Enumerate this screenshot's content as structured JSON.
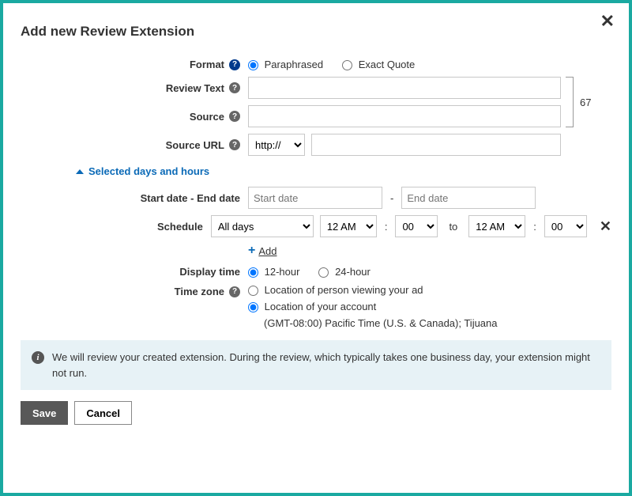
{
  "title": "Add new Review Extension",
  "labels": {
    "format": "Format",
    "review_text": "Review Text",
    "source": "Source",
    "source_url": "Source URL",
    "start_end": "Start date - End date",
    "schedule": "Schedule",
    "display_time": "Display time",
    "time_zone": "Time zone"
  },
  "format": {
    "paraphrased": "Paraphrased",
    "exact_quote": "Exact Quote"
  },
  "counter": "67",
  "source_url": {
    "protocol": "http://"
  },
  "section_toggle": "Selected days and hours",
  "date": {
    "start_ph": "Start date",
    "end_ph": "End date"
  },
  "schedule": {
    "days": "All days",
    "hour1": "12 AM",
    "min1": "00",
    "to": "to",
    "hour2": "12 AM",
    "min2": "00",
    "add": "Add"
  },
  "display_time": {
    "h12": "12-hour",
    "h24": "24-hour"
  },
  "time_zone": {
    "viewer": "Location of person viewing your ad",
    "account": "Location of your account",
    "account_sub": "(GMT-08:00) Pacific Time (U.S. & Canada); Tijuana"
  },
  "info": "We will review your created extension. During the review, which typically takes one business day, your extension might not run.",
  "buttons": {
    "save": "Save",
    "cancel": "Cancel"
  }
}
